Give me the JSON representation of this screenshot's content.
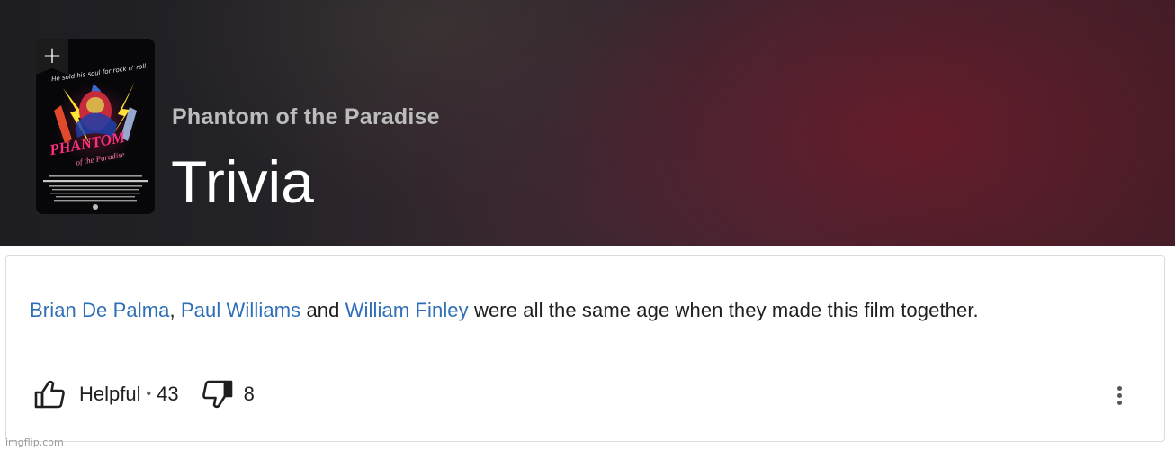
{
  "header": {
    "poster": {
      "tagline": "He sold his soul for rock n' roll",
      "title_art_line1": "PHANTOM",
      "title_art_line2": "of the Paradise",
      "add_icon": "plus-icon"
    },
    "movie_title": "Phantom of the Paradise",
    "page_heading": "Trivia"
  },
  "trivia": {
    "links": [
      "Brian De Palma",
      "Paul Williams",
      "William Finley"
    ],
    "sep_comma": ", ",
    "sep_and": " and ",
    "text_rest": " were all the same age when they made this film together.",
    "link_color": "#2e6fb7"
  },
  "votes": {
    "helpful_icon": "thumbs-up-icon",
    "helpful_label": "Helpful",
    "separator": "•",
    "helpful_count": "43",
    "not_helpful_icon": "thumbs-down-icon",
    "not_helpful_count": "8"
  },
  "more_options_icon": "more-vertical-icon",
  "watermark": "imgflip.com"
}
